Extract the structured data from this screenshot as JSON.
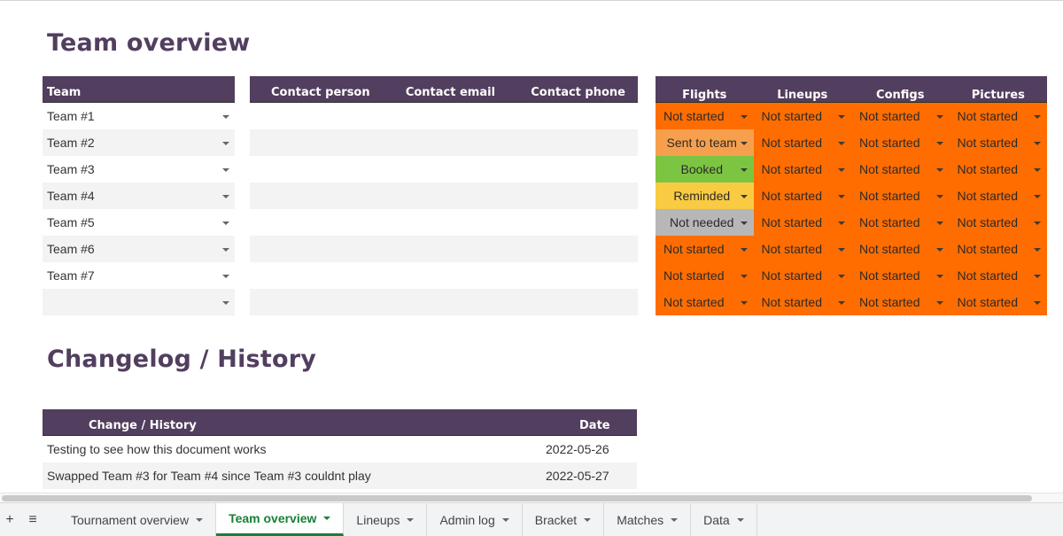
{
  "titles": {
    "team_overview": "Team overview",
    "changelog": "Changelog / History"
  },
  "team_table": {
    "header": "Team",
    "rows": [
      "Team #1",
      "Team #2",
      "Team #3",
      "Team #4",
      "Team #5",
      "Team #6",
      "Team #7",
      ""
    ]
  },
  "contact_table": {
    "headers": [
      "Contact person",
      "Contact email",
      "Contact phone"
    ]
  },
  "status_table": {
    "headers": [
      "Flights",
      "Lineups",
      "Configs",
      "Pictures"
    ],
    "rows": [
      [
        "Not started",
        "Not started",
        "Not started",
        "Not started"
      ],
      [
        "Sent to team",
        "Not started",
        "Not started",
        "Not started"
      ],
      [
        "Booked",
        "Not started",
        "Not started",
        "Not started"
      ],
      [
        "Reminded",
        "Not started",
        "Not started",
        "Not started"
      ],
      [
        "Not needed",
        "Not started",
        "Not started",
        "Not started"
      ],
      [
        "Not started",
        "Not started",
        "Not started",
        "Not started"
      ],
      [
        "Not started",
        "Not started",
        "Not started",
        "Not started"
      ],
      [
        "Not started",
        "Not started",
        "Not started",
        "Not started"
      ]
    ],
    "status_colors": {
      "Not started": "#ff6d01",
      "Sent to team": "#f6a04d",
      "Booked": "#7cc542",
      "Reminded": "#f9cb43",
      "Not needed": "#b7b7b7"
    }
  },
  "changelog": {
    "headers": [
      "Change / History",
      "Date"
    ],
    "rows": [
      {
        "change": "Testing to see how this document works",
        "date": "2022-05-26"
      },
      {
        "change": "Swapped Team #3 for Team #4 since Team #3 couldnt play",
        "date": "2022-05-27"
      }
    ]
  },
  "sheet_tabs": {
    "add_icon": "plus-icon",
    "list_icon": "menu-icon",
    "tabs": [
      {
        "label": "Tournament overview",
        "active": false
      },
      {
        "label": "Team overview",
        "active": true
      },
      {
        "label": "Lineups",
        "active": false
      },
      {
        "label": "Admin log",
        "active": false
      },
      {
        "label": "Bracket",
        "active": false
      },
      {
        "label": "Matches",
        "active": false
      },
      {
        "label": "Data",
        "active": false
      }
    ]
  },
  "colors": {
    "header_bg": "#523e5e",
    "title": "#523e5e",
    "active_tab": "#188038"
  }
}
